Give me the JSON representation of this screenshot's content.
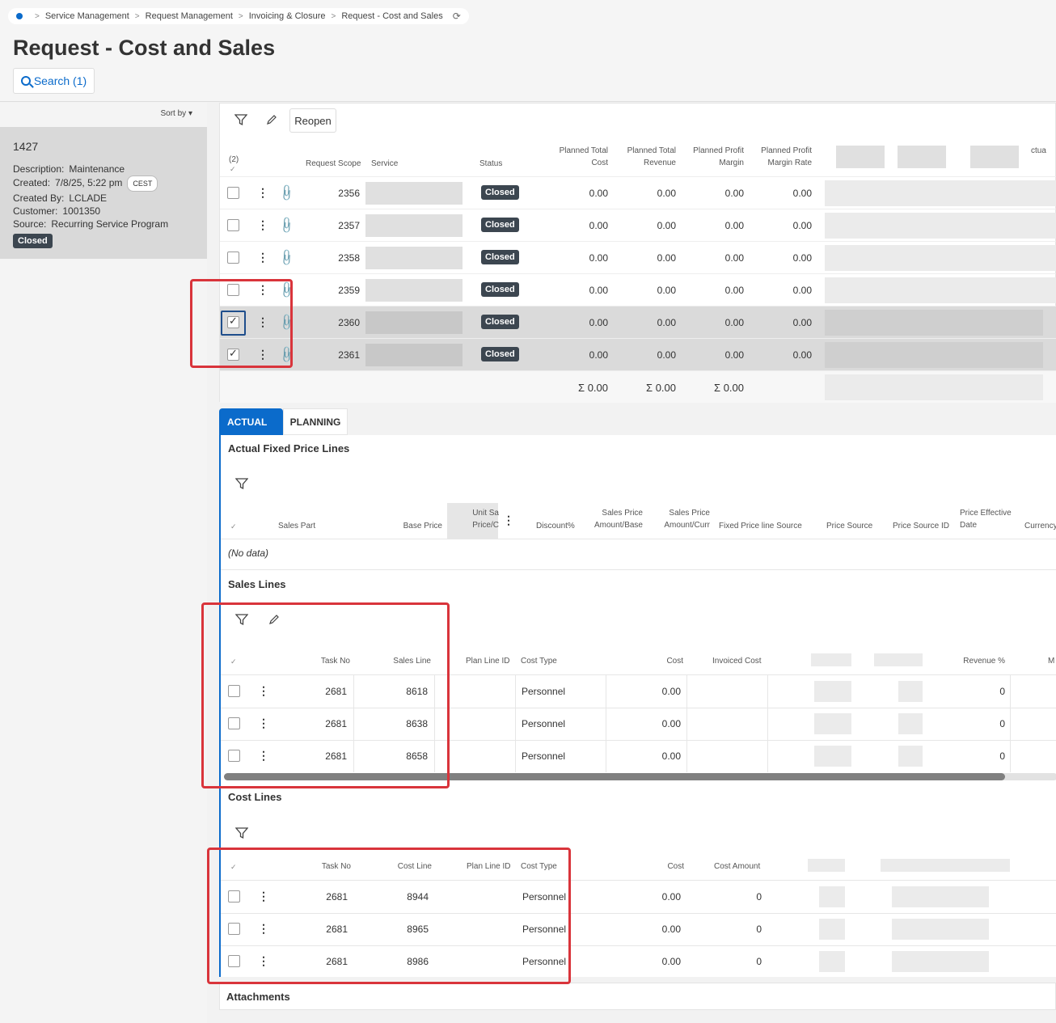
{
  "breadcrumb": [
    "Service Management",
    "Request Management",
    "Invoicing & Closure",
    "Request - Cost and Sales"
  ],
  "page_title": "Request - Cost and Sales",
  "search_label": "Search (1)",
  "sort_label": "Sort by",
  "card": {
    "id": "1427",
    "description_label": "Description:",
    "description": "Maintenance",
    "created_label": "Created:",
    "created": "7/8/25, 5:22 pm",
    "tz": "CEST",
    "created_by_label": "Created By:",
    "created_by": "LCLADE",
    "customer_label": "Customer:",
    "customer": "1001350",
    "source_label": "Source:",
    "source": "Recurring Service Program",
    "status": "Closed"
  },
  "top": {
    "reopen_label": "Reopen",
    "selected_count": "(2)",
    "columns": {
      "request_scope": "Request Scope",
      "service": "Service",
      "status": "Status",
      "ptc": [
        "Planned Total",
        "Cost"
      ],
      "ptr": [
        "Planned Total",
        "Revenue"
      ],
      "ppm": [
        "Planned Profit",
        "Margin"
      ],
      "ppmr": [
        "Planned Profit",
        "Margin Rate"
      ],
      "actual_partial": "ctua"
    },
    "rows": [
      {
        "scope": "2356",
        "status": "Closed",
        "ptc": "0.00",
        "ptr": "0.00",
        "ppm": "0.00",
        "ppmr": "0.00"
      },
      {
        "scope": "2357",
        "status": "Closed",
        "ptc": "0.00",
        "ptr": "0.00",
        "ppm": "0.00",
        "ppmr": "0.00"
      },
      {
        "scope": "2358",
        "status": "Closed",
        "ptc": "0.00",
        "ptr": "0.00",
        "ppm": "0.00",
        "ppmr": "0.00"
      },
      {
        "scope": "2359",
        "status": "Closed",
        "ptc": "0.00",
        "ptr": "0.00",
        "ppm": "0.00",
        "ppmr": "0.00"
      },
      {
        "scope": "2360",
        "status": "Closed",
        "ptc": "0.00",
        "ptr": "0.00",
        "ppm": "0.00",
        "ppmr": "0.00"
      },
      {
        "scope": "2361",
        "status": "Closed",
        "ptc": "0.00",
        "ptr": "0.00",
        "ppm": "0.00",
        "ppmr": "0.00"
      }
    ],
    "sums": [
      "Σ 0.00",
      "Σ 0.00",
      "Σ 0.00"
    ]
  },
  "tabs": {
    "actual": "ACTUAL",
    "planning": "PLANNING"
  },
  "fixed": {
    "title": "Actual Fixed Price Lines",
    "columns": {
      "sales_part": "Sales Part",
      "base_price": "Base Price",
      "unit_sales": [
        "Unit Sa",
        "Price/C"
      ],
      "discount": "Discount%",
      "spab": [
        "Sales Price",
        "Amount/Base"
      ],
      "spac": [
        "Sales Price",
        "Amount/Curr"
      ],
      "fpls": "Fixed Price line Source",
      "price_source": "Price Source",
      "price_source_id": "Price Source ID",
      "ped": [
        "Price Effective",
        "Date"
      ],
      "currency": "Currency"
    },
    "no_data": "(No data)"
  },
  "sales": {
    "title": "Sales Lines",
    "columns": {
      "task_no": "Task No",
      "sales_line": "Sales Line",
      "plan_line_id": "Plan Line ID",
      "cost_type": "Cost Type",
      "cost": "Cost",
      "invoiced_cost": "Invoiced Cost",
      "revenue_pct": "Revenue %",
      "m_partial": "M"
    },
    "rows": [
      {
        "task": "2681",
        "line": "8618",
        "type": "Personnel",
        "cost": "0.00",
        "rev": "0"
      },
      {
        "task": "2681",
        "line": "8638",
        "type": "Personnel",
        "cost": "0.00",
        "rev": "0"
      },
      {
        "task": "2681",
        "line": "8658",
        "type": "Personnel",
        "cost": "0.00",
        "rev": "0"
      }
    ]
  },
  "cost": {
    "title": "Cost Lines",
    "columns": {
      "task_no": "Task No",
      "cost_line": "Cost Line",
      "plan_line_id": "Plan Line ID",
      "cost_type": "Cost Type",
      "cost": "Cost",
      "cost_amount": "Cost Amount"
    },
    "rows": [
      {
        "task": "2681",
        "line": "8944",
        "type": "Personnel",
        "cost": "0.00",
        "amount": "0"
      },
      {
        "task": "2681",
        "line": "8965",
        "type": "Personnel",
        "cost": "0.00",
        "amount": "0"
      },
      {
        "task": "2681",
        "line": "8986",
        "type": "Personnel",
        "cost": "0.00",
        "amount": "0"
      }
    ]
  },
  "attachments_title": "Attachments",
  "colors": {
    "accent": "#0b6bcb",
    "badge": "#3c4650",
    "highlight": "#d9343b"
  }
}
